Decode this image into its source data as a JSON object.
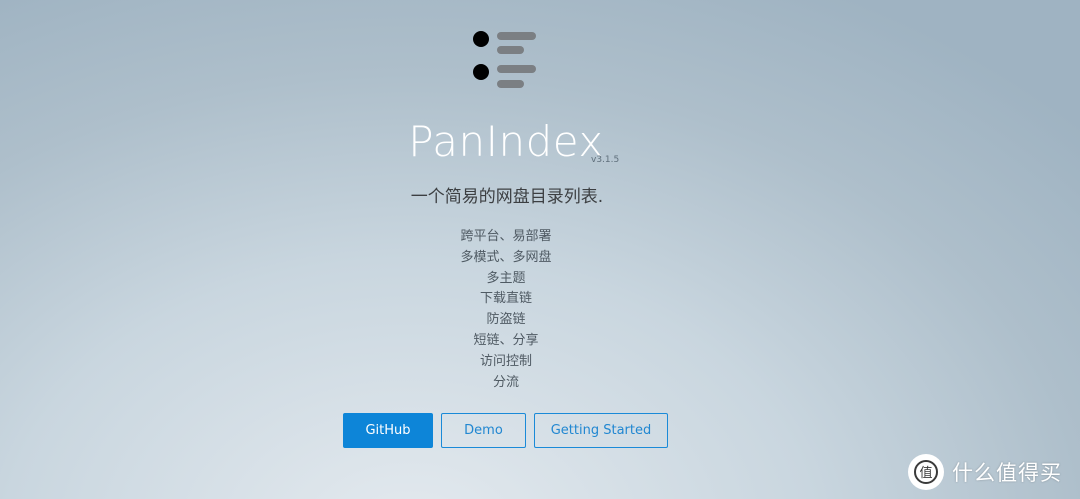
{
  "app": {
    "name": "PanIndex",
    "version": "v3.1.5",
    "tagline": "一个简易的网盘目录列表."
  },
  "features": [
    "跨平台、易部署",
    "多模式、多网盘",
    "多主题",
    "下载直链",
    "防盗链",
    "短链、分享",
    "访问控制",
    "分流"
  ],
  "buttons": {
    "github": "GitHub",
    "demo": "Demo",
    "getting_started": "Getting Started"
  },
  "watermark": {
    "text": "什么值得买",
    "icon": "smzdm-logo-icon"
  },
  "colors": {
    "accent": "#0d85d8",
    "logo_dot": "#000000",
    "logo_bar": "#7b7f83"
  }
}
